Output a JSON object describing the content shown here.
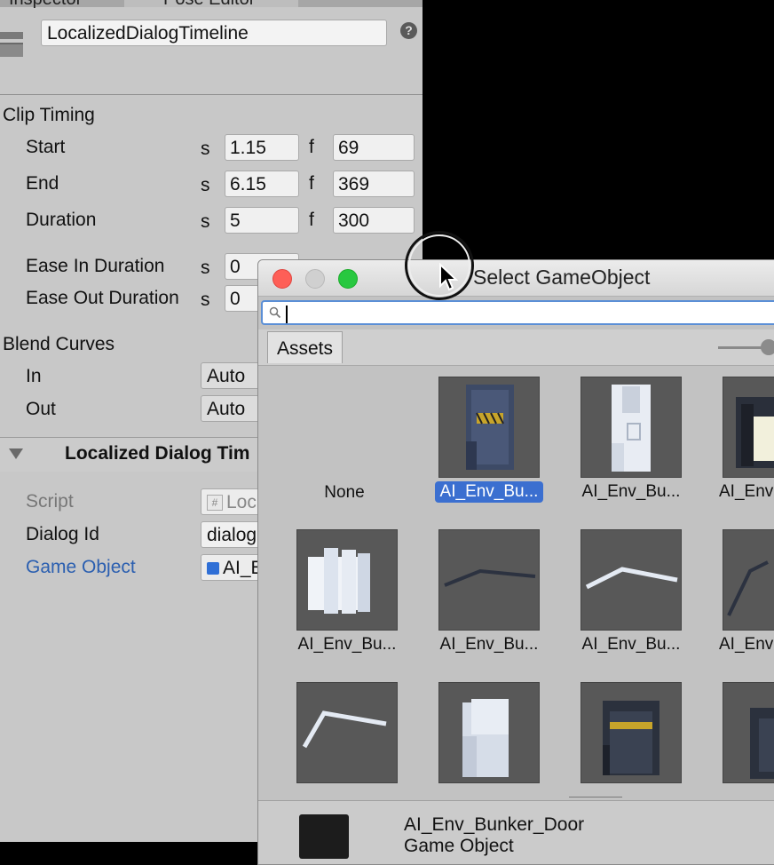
{
  "inspector": {
    "tabs": [
      "Inspector",
      "Pose Editor"
    ],
    "object_name": "LocalizedDialogTimeline",
    "help_icon": "question-icon",
    "clip_timing": {
      "header": "Clip Timing",
      "rows": [
        {
          "label": "Start",
          "s_unit": "s",
          "s_value": "1.15",
          "f_unit": "f",
          "f_value": "69"
        },
        {
          "label": "End",
          "s_unit": "s",
          "s_value": "6.15",
          "f_unit": "f",
          "f_value": "369"
        },
        {
          "label": "Duration",
          "s_unit": "s",
          "s_value": "5",
          "f_unit": "f",
          "f_value": "300"
        }
      ],
      "ease_in": {
        "label": "Ease In Duration",
        "s_unit": "s",
        "s_value": "0"
      },
      "ease_out": {
        "label": "Ease Out Duration",
        "s_unit": "s",
        "s_value": "0"
      }
    },
    "blend_curves": {
      "header": "Blend Curves",
      "in_label": "In",
      "in_value": "Auto",
      "out_label": "Out",
      "out_value": "Auto"
    },
    "component": {
      "title": "Localized Dialog Tim",
      "script_label": "Script",
      "script_value": "Loc",
      "dialog_id_label": "Dialog Id",
      "dialog_id_value": "dialog",
      "game_object_label": "Game Object",
      "game_object_value": "AI_E"
    }
  },
  "dialog": {
    "title": "Select GameObject",
    "search_placeholder": "",
    "tab": "Assets",
    "items": [
      {
        "caption": "None",
        "selected": false
      },
      {
        "caption": "AI_Env_Bu...",
        "selected": true
      },
      {
        "caption": "AI_Env_Bu...",
        "selected": false
      },
      {
        "caption": "AI_Env",
        "selected": false
      },
      {
        "caption": "AI_Env_Bu...",
        "selected": false
      },
      {
        "caption": "AI_Env_Bu...",
        "selected": false
      },
      {
        "caption": "AI_Env_Bu...",
        "selected": false
      },
      {
        "caption": "AI_Env",
        "selected": false
      }
    ],
    "footer": {
      "name": "AI_Env_Bunker_Door",
      "type": "Game Object"
    },
    "colors": {
      "close": "#fe5f57",
      "minimize": "#d0d0d0",
      "zoom": "#28c840",
      "selection": "#3b6fd0"
    }
  }
}
